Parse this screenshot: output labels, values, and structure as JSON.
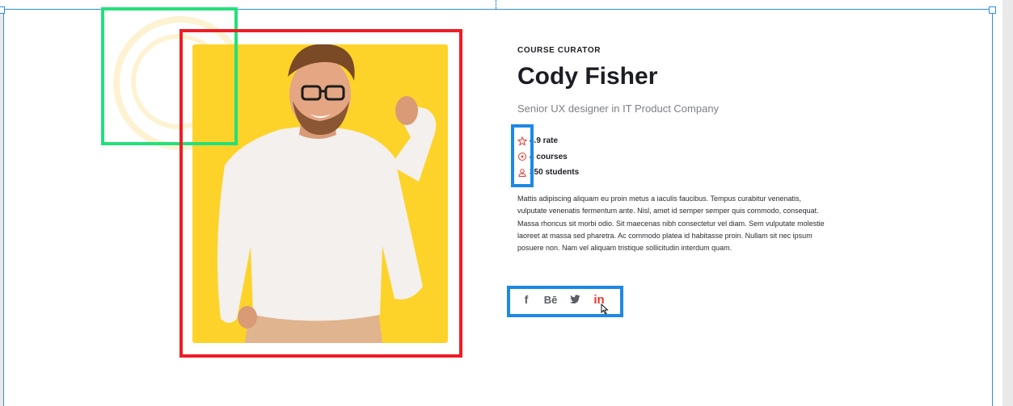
{
  "curator": {
    "role_label": "COURSE CURATOR",
    "name": "Cody Fisher",
    "title": "Senior UX designer in IT Product Company",
    "stats": [
      {
        "icon": "star-icon",
        "label": "4.9 rate"
      },
      {
        "icon": "play-circle-icon",
        "label": "4 courses"
      },
      {
        "icon": "user-icon",
        "label": "350 students"
      }
    ],
    "bio": "Mattis adipiscing aliquam eu proin metus a iaculis faucibus. Tempus curabitur venenatis, vulputate venenatis fermentum ante. Nisl, amet id semper semper quis commodo, consequat. Massa rhoncus sit morbi odio. Sit maecenas nibh consectetur vel diam. Sem vulputate molestie laoreet at massa sed pharetra. Ac commodo platea id habitasse proin. Nullam sit nec ipsum posuere non. Nam vel aliquam tristique sollicitudin interdum quam.",
    "social": [
      {
        "icon": "facebook-icon",
        "glyph": "f"
      },
      {
        "icon": "behance-icon",
        "glyph": "Bē"
      },
      {
        "icon": "twitter-icon",
        "glyph": ""
      },
      {
        "icon": "linkedin-icon",
        "glyph": "in"
      }
    ]
  },
  "colors": {
    "accent": "#e8372c",
    "photo_bg": "#fdd32a",
    "selection_green": "#23e07a",
    "selection_red": "#ee1c25",
    "selection_blue": "#1e88e5",
    "frame_blue": "#2d8bf0"
  }
}
